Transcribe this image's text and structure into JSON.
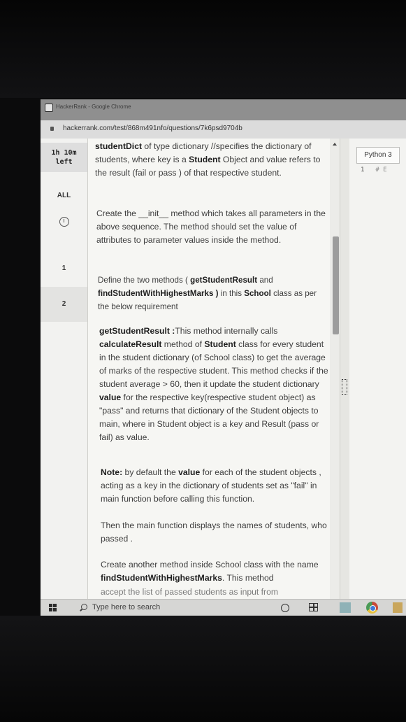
{
  "browser": {
    "window_title": "HackerRank - Google Chrome",
    "url": "hackerrank.com/test/868m491nfo/questions/7k6psd9704b"
  },
  "sidebar": {
    "timer_line1": "1h 10m",
    "timer_line2": "left",
    "all_label": "ALL",
    "question_1": "1",
    "question_2": "2"
  },
  "question": {
    "p1": {
      "term": "studentDict",
      "t1": " of type dictionary //specifies the dictionary of students, where key is a ",
      "student": "Student",
      "t2": " Object and value refers to the result (fail or pass ) of that respective student."
    },
    "p2": "Create the __init__ method which takes all parameters in the above sequence. The method should set the value of attributes to parameter values inside the method.",
    "p3": {
      "t1": "Define the two methods ( ",
      "m1": "getStudentResult",
      "t2": " and ",
      "m2": "findStudentWithHighestMarks )",
      "t3": " in this ",
      "school": "School",
      "t4": " class as per the below requirement"
    },
    "p4": {
      "m1": "getStudentResult :",
      "t1": "This method internally calls ",
      "m2": "calculateResult",
      "t2": " method of ",
      "student": "Student",
      "t3": " class for every student in the student dictionary (of School class) to get the average of marks of the respective student. This method checks if the student average > 60, then it update the student dictionary ",
      "value": "value",
      "t4": " for the respective key(respective student object) as \"pass\" and returns that dictionary of the Student objects  to main, where in Student object is a key and Result (pass or fail) as value."
    },
    "p5": {
      "note": "Note:",
      "t1": " by default the ",
      "value": "value",
      "t2": " for each of the student objects , acting as a key in the dictionary of students set as \"fail\" in main function before calling this function."
    },
    "p6": "Then the main function displays the names of students, who passed .",
    "p7": {
      "t1": "Create another method inside School class with the name ",
      "m1": "findStudentWithHighestMarks",
      "t2": ". This method"
    },
    "p8": "accept the list of passed students as input from"
  },
  "editor": {
    "language": "Python 3",
    "line_number": "1",
    "line_marker": "# E"
  },
  "taskbar": {
    "search_placeholder": "Type here to search"
  }
}
